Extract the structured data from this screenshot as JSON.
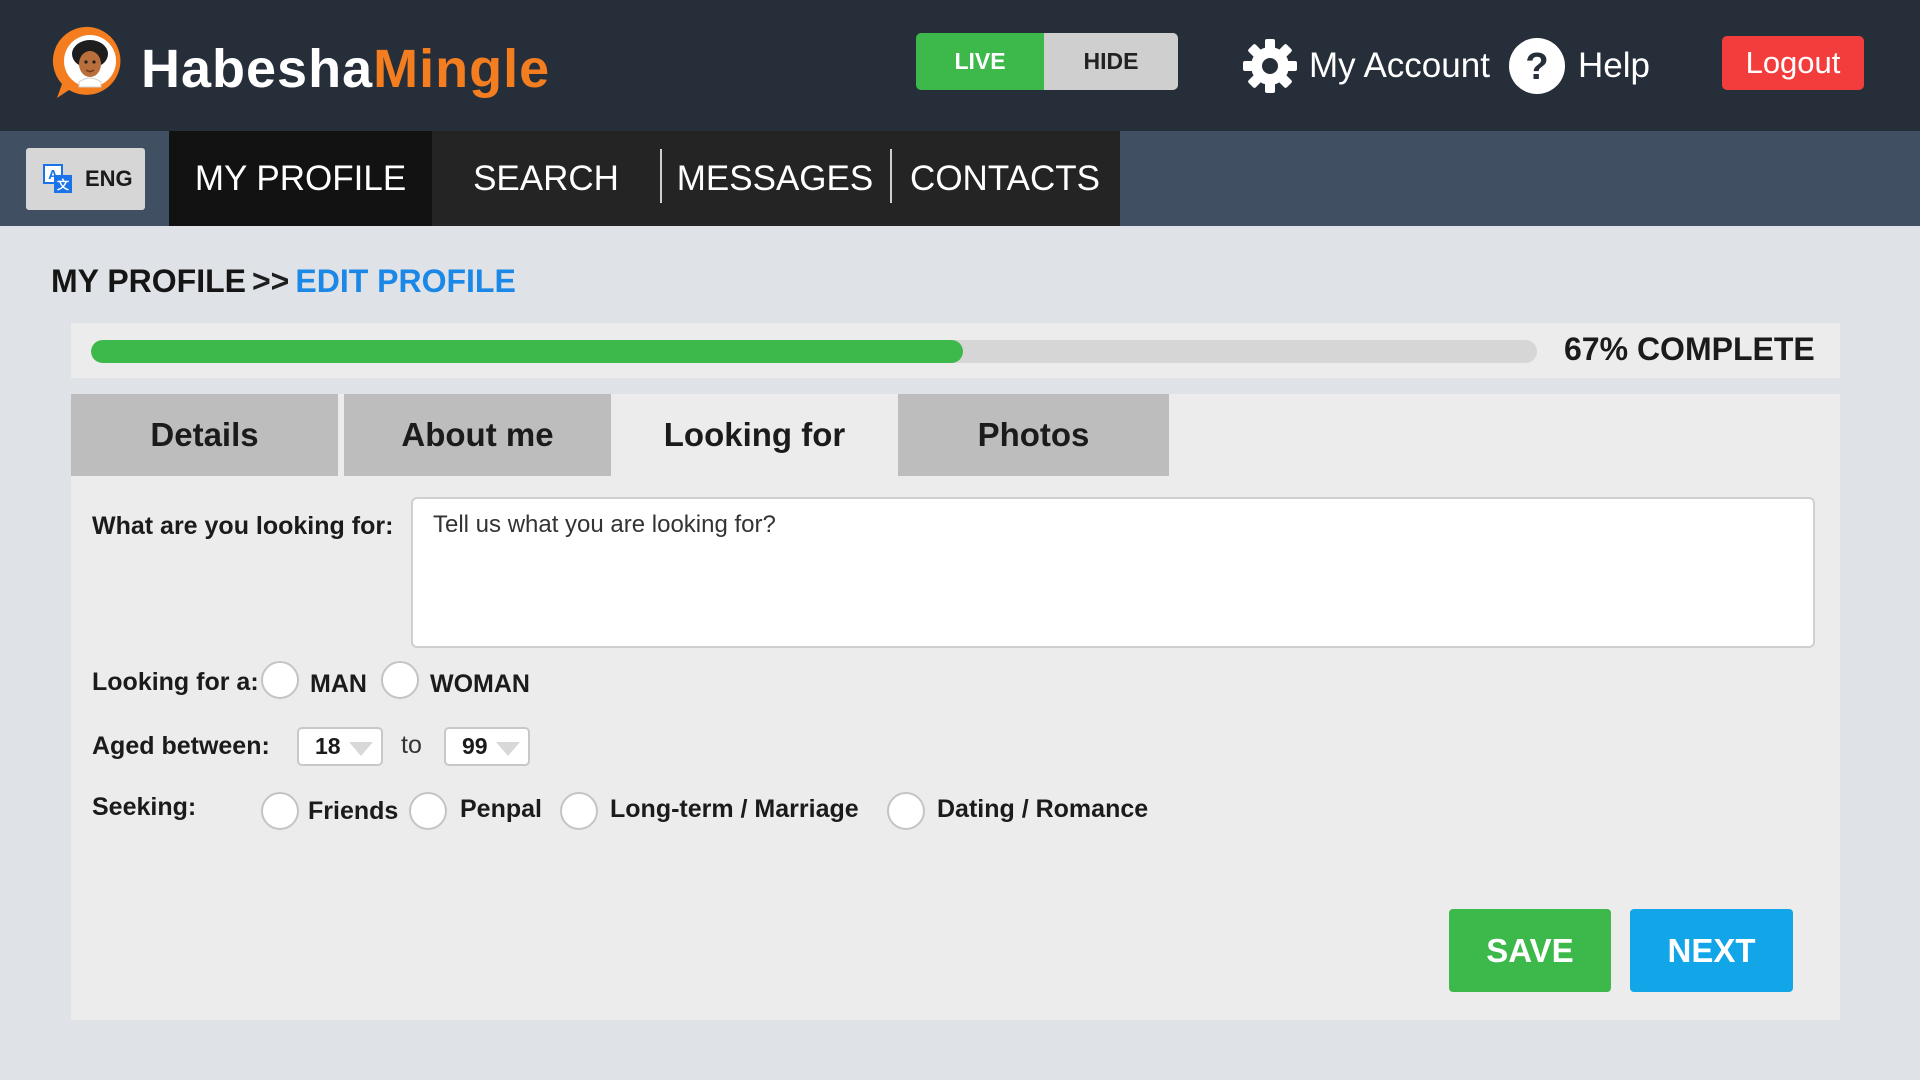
{
  "brand": {
    "name_part1": "Habesha",
    "name_part2": "Mingle",
    "accent": "#f47d20"
  },
  "header": {
    "visibility_toggle": {
      "live_label": "LIVE",
      "hide_label": "HIDE",
      "selected": "LIVE"
    },
    "account_label": "My Account",
    "help_label": "Help",
    "logout_label": "Logout"
  },
  "nav": {
    "language_label": "ENG",
    "tabs": [
      "MY PROFILE",
      "SEARCH",
      "MESSAGES",
      "CONTACTS"
    ],
    "active_tab": "MY PROFILE"
  },
  "breadcrumb": {
    "parent": "MY PROFILE",
    "separator": ">>",
    "current": "EDIT PROFILE"
  },
  "progress": {
    "percent": 67,
    "label": "67% COMPLETE"
  },
  "profile_tabs": {
    "items": [
      "Details",
      "About me",
      "Looking for",
      "Photos"
    ],
    "active": "Looking for"
  },
  "form": {
    "looking_for_label": "What are you looking for:",
    "looking_for_placeholder": "Tell us what you are looking for?",
    "looking_for_value": "",
    "gender_label": "Looking for a:",
    "gender_options": [
      "MAN",
      "WOMAN"
    ],
    "age_label": "Aged between:",
    "age_min": "18",
    "age_to": "to",
    "age_max": "99",
    "seeking_label": "Seeking:",
    "seeking_options": [
      "Friends",
      "Penpal",
      "Long-term / Marriage",
      "Dating / Romance"
    ]
  },
  "actions": {
    "save_label": "SAVE",
    "next_label": "NEXT"
  },
  "colors": {
    "green": "#3db84a",
    "blue": "#12a6e8",
    "red": "#f33d3d",
    "link_blue": "#1b87e6"
  }
}
